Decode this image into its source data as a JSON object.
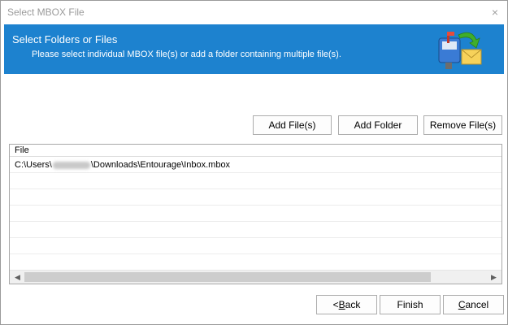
{
  "window": {
    "title": "Select MBOX File",
    "close_glyph": "×"
  },
  "banner": {
    "title": "Select Folders or Files",
    "subtitle": "Please select individual MBOX file(s) or add a folder containing multiple file(s).",
    "icon": "mailbox-envelope-icon",
    "background_color": "#1d82cf"
  },
  "toolbar": {
    "add_files_label": "Add File(s)",
    "add_folder_label": "Add Folder",
    "remove_files_label": "Remove File(s)"
  },
  "file_list": {
    "column_header": "File",
    "rows": [
      {
        "path_prefix": "C:\\Users\\",
        "path_suffix": "\\Downloads\\Entourage\\Inbox.mbox"
      }
    ],
    "scroll_left_glyph": "◀",
    "scroll_right_glyph": "▶"
  },
  "footer": {
    "back_mnemonic": "B",
    "back_rest": "ack",
    "back_prefix": "<",
    "finish_label": "Finish",
    "cancel_mnemonic": "C",
    "cancel_rest": "ancel"
  }
}
